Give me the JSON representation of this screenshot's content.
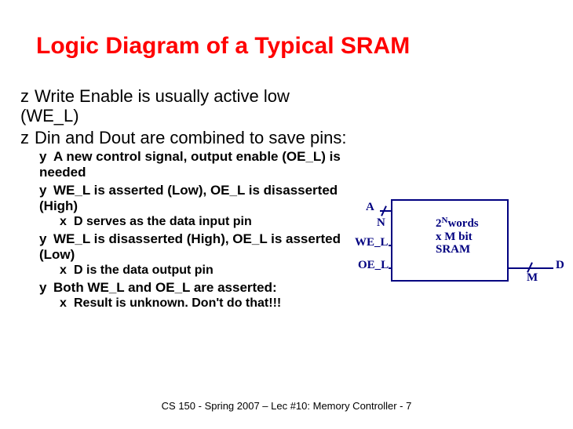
{
  "title": "Logic Diagram of a Typical SRAM",
  "bullets": {
    "b1a": "Write Enable is usually active low (WE_L)",
    "b1b": "Din and Dout are combined to save pins:",
    "b2a": "A new control signal, output enable (OE_L) is needed",
    "b2b": "WE_L is asserted (Low), OE_L is disasserted (High)",
    "b3a": "D serves as the data input pin",
    "b2c": "WE_L is disasserted (High), OE_L is asserted (Low)",
    "b3b": "D is the data output pin",
    "b2d": "Both WE_L and OE_L are asserted:",
    "b3c": "Result is unknown.  Don't do that!!!"
  },
  "glyphs": {
    "z": "z",
    "y": "y",
    "x": "x"
  },
  "diagram": {
    "A": "A",
    "N": "N",
    "WE_L": "WE_L",
    "OE_L": "OE_L",
    "D": "D",
    "M": "M",
    "box_line1_pre": "2",
    "box_line1_exp": "N",
    "box_line1_post": "words",
    "box_line2": " x  M bit",
    "box_line3": "SRAM"
  },
  "footer": "CS 150 - Spring  2007 – Lec #10: Memory Controller - 7"
}
